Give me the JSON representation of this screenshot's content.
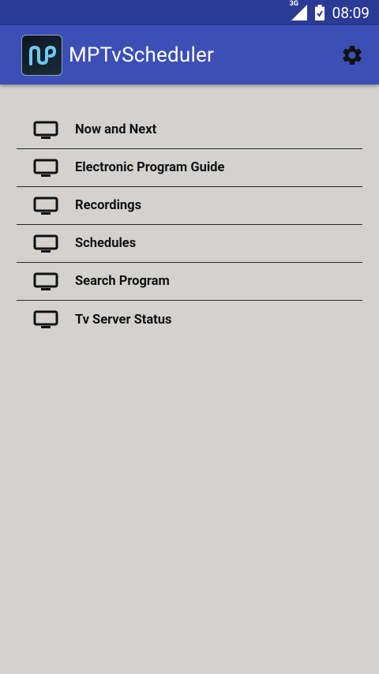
{
  "status_bar": {
    "network": "3G",
    "time": "08:09"
  },
  "app_bar": {
    "title": "MPTvScheduler"
  },
  "menu": {
    "items": [
      {
        "label": "Now and Next"
      },
      {
        "label": "Electronic Program Guide"
      },
      {
        "label": "Recordings"
      },
      {
        "label": "Schedules"
      },
      {
        "label": "Search Program"
      },
      {
        "label": "Tv Server Status"
      }
    ]
  }
}
